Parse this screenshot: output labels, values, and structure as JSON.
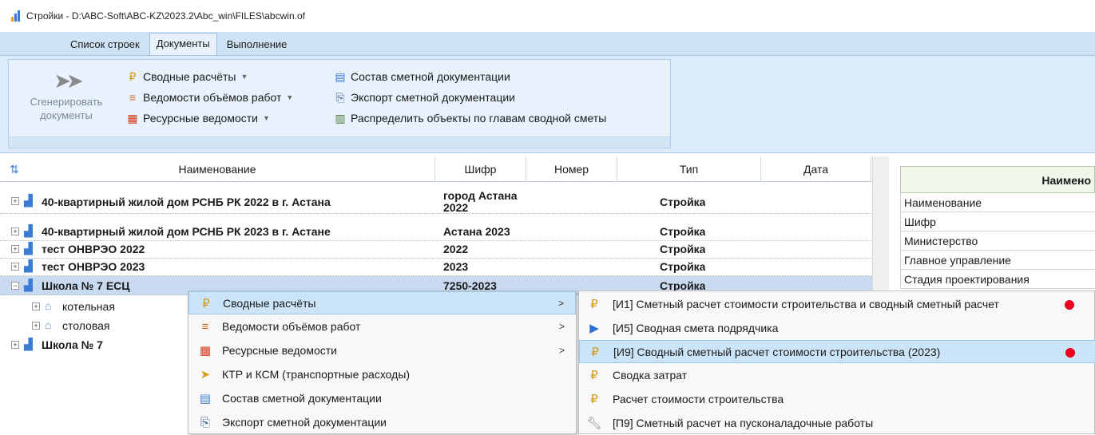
{
  "window": {
    "title": "Стройки - D:\\ABC-Soft\\ABC-KZ\\2023.2\\Abc_win\\FILES\\abcwin.of"
  },
  "ribbon": {
    "tabs": [
      {
        "label": "Список строек",
        "active": false
      },
      {
        "label": "Документы",
        "active": true
      },
      {
        "label": "Выполнение",
        "active": false
      }
    ],
    "generate_label_1": "Сгенерировать",
    "generate_label_2": "документы",
    "buttons": {
      "summary_calcs": "Сводные расчёты",
      "work_volumes": "Ведомости объёмов работ",
      "resource_sheets": "Ресурсные ведомости",
      "estimate_docs": "Состав сметной документации",
      "export_docs": "Экспорт сметной документации",
      "distribute": "Распределить объекты по главам сводной сметы"
    }
  },
  "grid": {
    "columns": [
      "Наименование",
      "Шифр",
      "Номер",
      "Тип",
      "Дата"
    ],
    "rows": [
      {
        "name": "40-квартирный жилой дом РСНБ РК 2022 в г. Астана",
        "code_1": "город Астана",
        "code_2": "2022",
        "number": "",
        "type": "Стройка",
        "date": ""
      },
      {
        "name": "40-квартирный жилой дом РСНБ РК 2023 в г. Астане",
        "code": "Астана 2023",
        "number": "",
        "type": "Стройка",
        "date": ""
      },
      {
        "name": "тест ОНВРЭО 2022",
        "code": "2022",
        "number": "",
        "type": "Стройка",
        "date": ""
      },
      {
        "name": "тест ОНВРЭО 2023",
        "code": "2023",
        "number": "",
        "type": "Стройка",
        "date": ""
      },
      {
        "name": "Школа № 7 ЕСЦ",
        "code": "7250-2023",
        "number": "",
        "type": "Стройка",
        "date": ""
      },
      {
        "name": "котельная"
      },
      {
        "name": "столовая"
      },
      {
        "name": "Школа № 7"
      }
    ]
  },
  "properties": {
    "header": "Наимено",
    "rows": [
      "Наименование",
      "Шифр",
      "Министерство",
      "Главное управление",
      "Стадия проектирования"
    ]
  },
  "context_menu": {
    "items": [
      {
        "label": "Сводные расчёты",
        "submenu": true
      },
      {
        "label": "Ведомости объёмов работ",
        "submenu": true
      },
      {
        "label": "Ресурсные ведомости",
        "submenu": true
      },
      {
        "label": "КТР и КСМ (транспортные расходы)",
        "submenu": false
      },
      {
        "label": "Состав сметной документации",
        "submenu": false
      },
      {
        "label": "Экспорт сметной документации",
        "submenu": false
      }
    ]
  },
  "submenu": {
    "items": [
      {
        "label": "[И1] Сметный расчет стоимости строительства и сводный сметный расчет",
        "marked": true
      },
      {
        "label": "[И5] Сводная смета подрядчика",
        "marked": false
      },
      {
        "label": "[И9] Сводный сметный расчет стоимости строительства (2023)",
        "marked": true
      },
      {
        "label": "Сводка затрат",
        "marked": false
      },
      {
        "label": "Расчет стоимости строительства",
        "marked": false
      },
      {
        "label": "[П9] Сметный расчет на пусконаладочные работы",
        "marked": false
      }
    ]
  },
  "colors": {
    "ribbon_bg": "#dcebf9",
    "selection": "#c8daf0",
    "highlight": "#cce4f7",
    "marker_red": "#e8001c"
  }
}
